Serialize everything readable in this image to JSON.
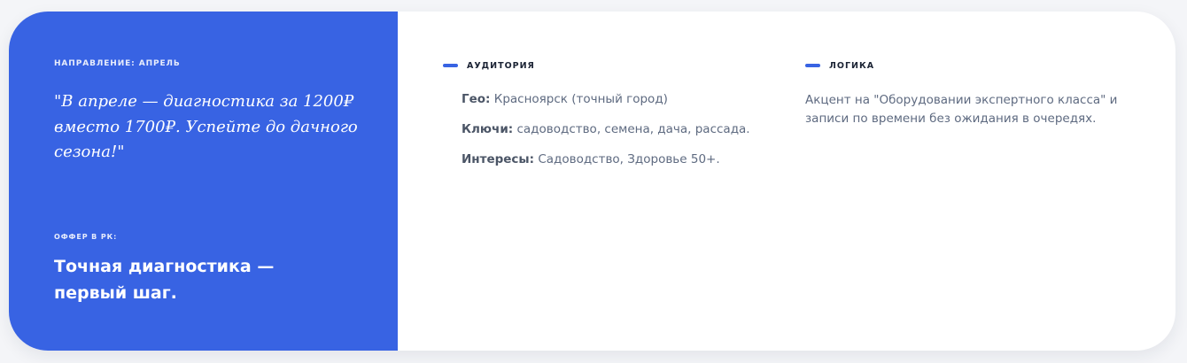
{
  "left_panel": {
    "direction_label": "НАПРАВЛЕНИЕ: АПРЕЛЬ",
    "quote": "\"В апреле — диагностика за 1200₽ вместо 1700₽. Успейте до дачного сезона!\"",
    "offer_label": "ОФФЕР В РК:",
    "offer_title": "Точная диагностика — первый шаг."
  },
  "audience": {
    "title": "АУДИТОРИЯ",
    "items": [
      {
        "key": "Гео:",
        "value": " Красноярск (точный город)"
      },
      {
        "key": "Ключи:",
        "value": " садоводство, семена, дача, рассада."
      },
      {
        "key": "Интересы:",
        "value": " Садоводство, Здоровье 50+."
      }
    ]
  },
  "logic": {
    "title": "ЛОГИКА",
    "text": "Акцент на \"Оборудовании экспертного класса\" и записи по времени без ожидания в очередях."
  },
  "colors": {
    "accent": "#3863e3",
    "heading": "#1b2334",
    "body_text": "#5e6a80",
    "background": "#f4f5f8"
  }
}
